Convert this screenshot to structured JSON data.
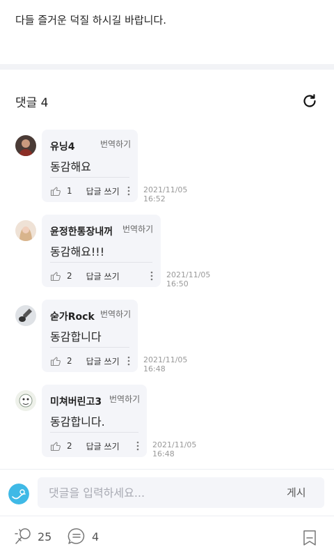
{
  "post": {
    "text": "다들 즐거운 덕질 하시길 바랍니다."
  },
  "comments_section": {
    "title": "댓글 4"
  },
  "comments": [
    {
      "author": "유닝4",
      "translate_label": "번역하기",
      "text": "동감해요",
      "likes": "1",
      "reply_label": "답글 쓰기",
      "date": "2021/11/05",
      "time": "16:52"
    },
    {
      "author": "윤정한통장내꺼",
      "translate_label": "번역하기",
      "text": "동감해요!!!",
      "likes": "2",
      "reply_label": "답글 쓰기",
      "date": "2021/11/05",
      "time": "16:50"
    },
    {
      "author": "숟가Rock",
      "translate_label": "번역하기",
      "text": "동감합니다",
      "likes": "2",
      "reply_label": "답글 쓰기",
      "date": "2021/11/05",
      "time": "16:48"
    },
    {
      "author": "미쳐버린고3",
      "translate_label": "번역하기",
      "text": "동감합니다.",
      "likes": "2",
      "reply_label": "답글 쓰기",
      "date": "2021/11/05",
      "time": "16:48"
    }
  ],
  "comment_input": {
    "placeholder": "댓글을 입력하세요...",
    "submit_label": "게시"
  },
  "bottom_bar": {
    "like_count": "25",
    "comment_count": "4"
  },
  "icons": {
    "refresh": "refresh-icon",
    "like": "thumbs-up-icon",
    "more": "more-vertical-icon",
    "cheer": "cheer-icon",
    "comment": "comment-icon",
    "bookmark": "bookmark-icon"
  }
}
